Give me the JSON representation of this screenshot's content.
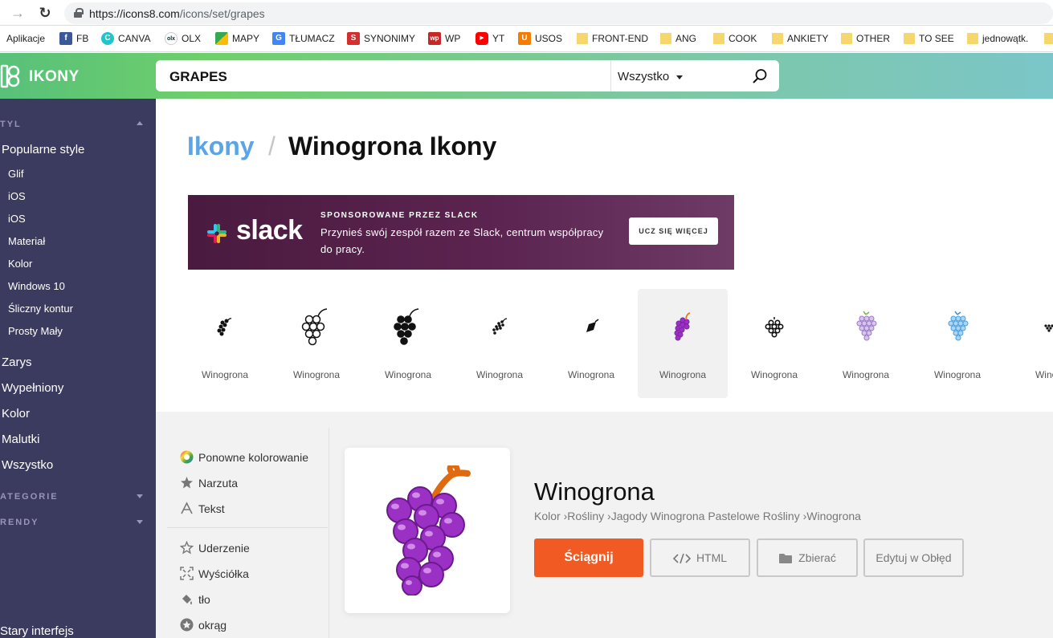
{
  "browser": {
    "url_host": "https://icons8.com",
    "url_path": "/icons/set/grapes"
  },
  "bookmarks": [
    {
      "label": "Aplikacje",
      "icon": "apps-icon",
      "color": ""
    },
    {
      "label": "FB",
      "icon": "facebook-icon",
      "color": "#3b5998"
    },
    {
      "label": "CANVA",
      "icon": "canva-icon",
      "color": "#20c4cb"
    },
    {
      "label": "OLX",
      "icon": "olx-icon",
      "color": "#002f34"
    },
    {
      "label": "MAPY",
      "icon": "maps-icon",
      "color": "#34a853"
    },
    {
      "label": "TŁUMACZ",
      "icon": "translate-icon",
      "color": "#4285f4"
    },
    {
      "label": "SYNONIMY",
      "icon": "synonyms-icon",
      "color": "#d32f2f"
    },
    {
      "label": "WP",
      "icon": "wp-icon",
      "color": "#c62828"
    },
    {
      "label": "YT",
      "icon": "youtube-icon",
      "color": "#ff0000"
    },
    {
      "label": "USOS",
      "icon": "usos-icon",
      "color": "#f57c00"
    },
    {
      "label": "FRONT-END",
      "icon": "folder-icon",
      "color": "#f5d76e"
    },
    {
      "label": "ANG",
      "icon": "folder-icon",
      "color": "#f5d76e"
    },
    {
      "label": "COOK",
      "icon": "folder-icon",
      "color": "#f5d76e"
    },
    {
      "label": "ANKIETY",
      "icon": "folder-icon",
      "color": "#f5d76e"
    },
    {
      "label": "OTHER",
      "icon": "folder-icon",
      "color": "#f5d76e"
    },
    {
      "label": "TO SEE",
      "icon": "folder-icon",
      "color": "#f5d76e"
    },
    {
      "label": "jednowątk.",
      "icon": "folder-icon",
      "color": "#f5d76e"
    }
  ],
  "header": {
    "logo_text": "IKONY",
    "search_value": "GRAPES",
    "search_scope": "Wszystko"
  },
  "sidebar": {
    "styl_label": "TYL",
    "popular_label": "Popularne style",
    "popular_items": [
      "Glif",
      "iOS",
      "iOS",
      "Materiał",
      "Kolor",
      "Windows 10",
      "Śliczny kontur",
      "Prosty Mały"
    ],
    "categories": [
      "Zarys",
      "Wypełniony",
      "Kolor",
      "Malutki",
      "Wszystko"
    ],
    "kategorie_label": "ATEGORIE",
    "trendy_label": "RENDY",
    "old_ui_label": "Stary interfejs"
  },
  "main": {
    "crumb_root": "Ikony",
    "crumb_slash": "/",
    "title": "Winogrona Ikony",
    "ad": {
      "brand": "slack",
      "sponsored": "SPONSOROWANE PRZEZ SLACK",
      "text": "Przynieś swój zespół razem ze Slack, centrum współpracy do pracy.",
      "button": "UCZ SIĘ WIĘCEJ"
    },
    "icon_results": [
      {
        "label": "Winogrona",
        "style": "small-black"
      },
      {
        "label": "Winogrona",
        "style": "outline"
      },
      {
        "label": "Winogrona",
        "style": "filled"
      },
      {
        "label": "Winogrona",
        "style": "small-dots"
      },
      {
        "label": "Winogrona",
        "style": "small-slanted"
      },
      {
        "label": "Winogrona",
        "style": "color-purple"
      },
      {
        "label": "Winogrona",
        "style": "small-outline"
      },
      {
        "label": "Winogrona",
        "style": "pastel-purple"
      },
      {
        "label": "Winogrona",
        "style": "pastel-blue"
      },
      {
        "label": "Winog",
        "style": "tiny"
      }
    ],
    "options_top": [
      {
        "label": "Ponowne kolorowanie",
        "icon": "recolor-icon"
      },
      {
        "label": "Narzuta",
        "icon": "overlay-icon"
      },
      {
        "label": "Tekst",
        "icon": "text-icon"
      }
    ],
    "options_bottom": [
      {
        "label": "Uderzenie",
        "icon": "stroke-icon"
      },
      {
        "label": "Wyściółka",
        "icon": "padding-icon"
      },
      {
        "label": "tło",
        "icon": "background-icon"
      },
      {
        "label": "okrąg",
        "icon": "circle-icon"
      }
    ],
    "detail": {
      "title": "Winogrona",
      "crumbs": "Kolor  ›Rośliny  ›Jagody Winogrona Pastelowe Rośliny  ›Winogrona",
      "download": "Ściągnij",
      "html": "HTML",
      "collect": "Zbierać",
      "edit": "Edytuj w Obłęd"
    }
  },
  "colors": {
    "header_green": "#6fcf6b",
    "sidebar": "#3b3a5f",
    "download": "#f15a22",
    "crumb_link": "#5aa5e8",
    "grape": "#8e2bb3"
  }
}
